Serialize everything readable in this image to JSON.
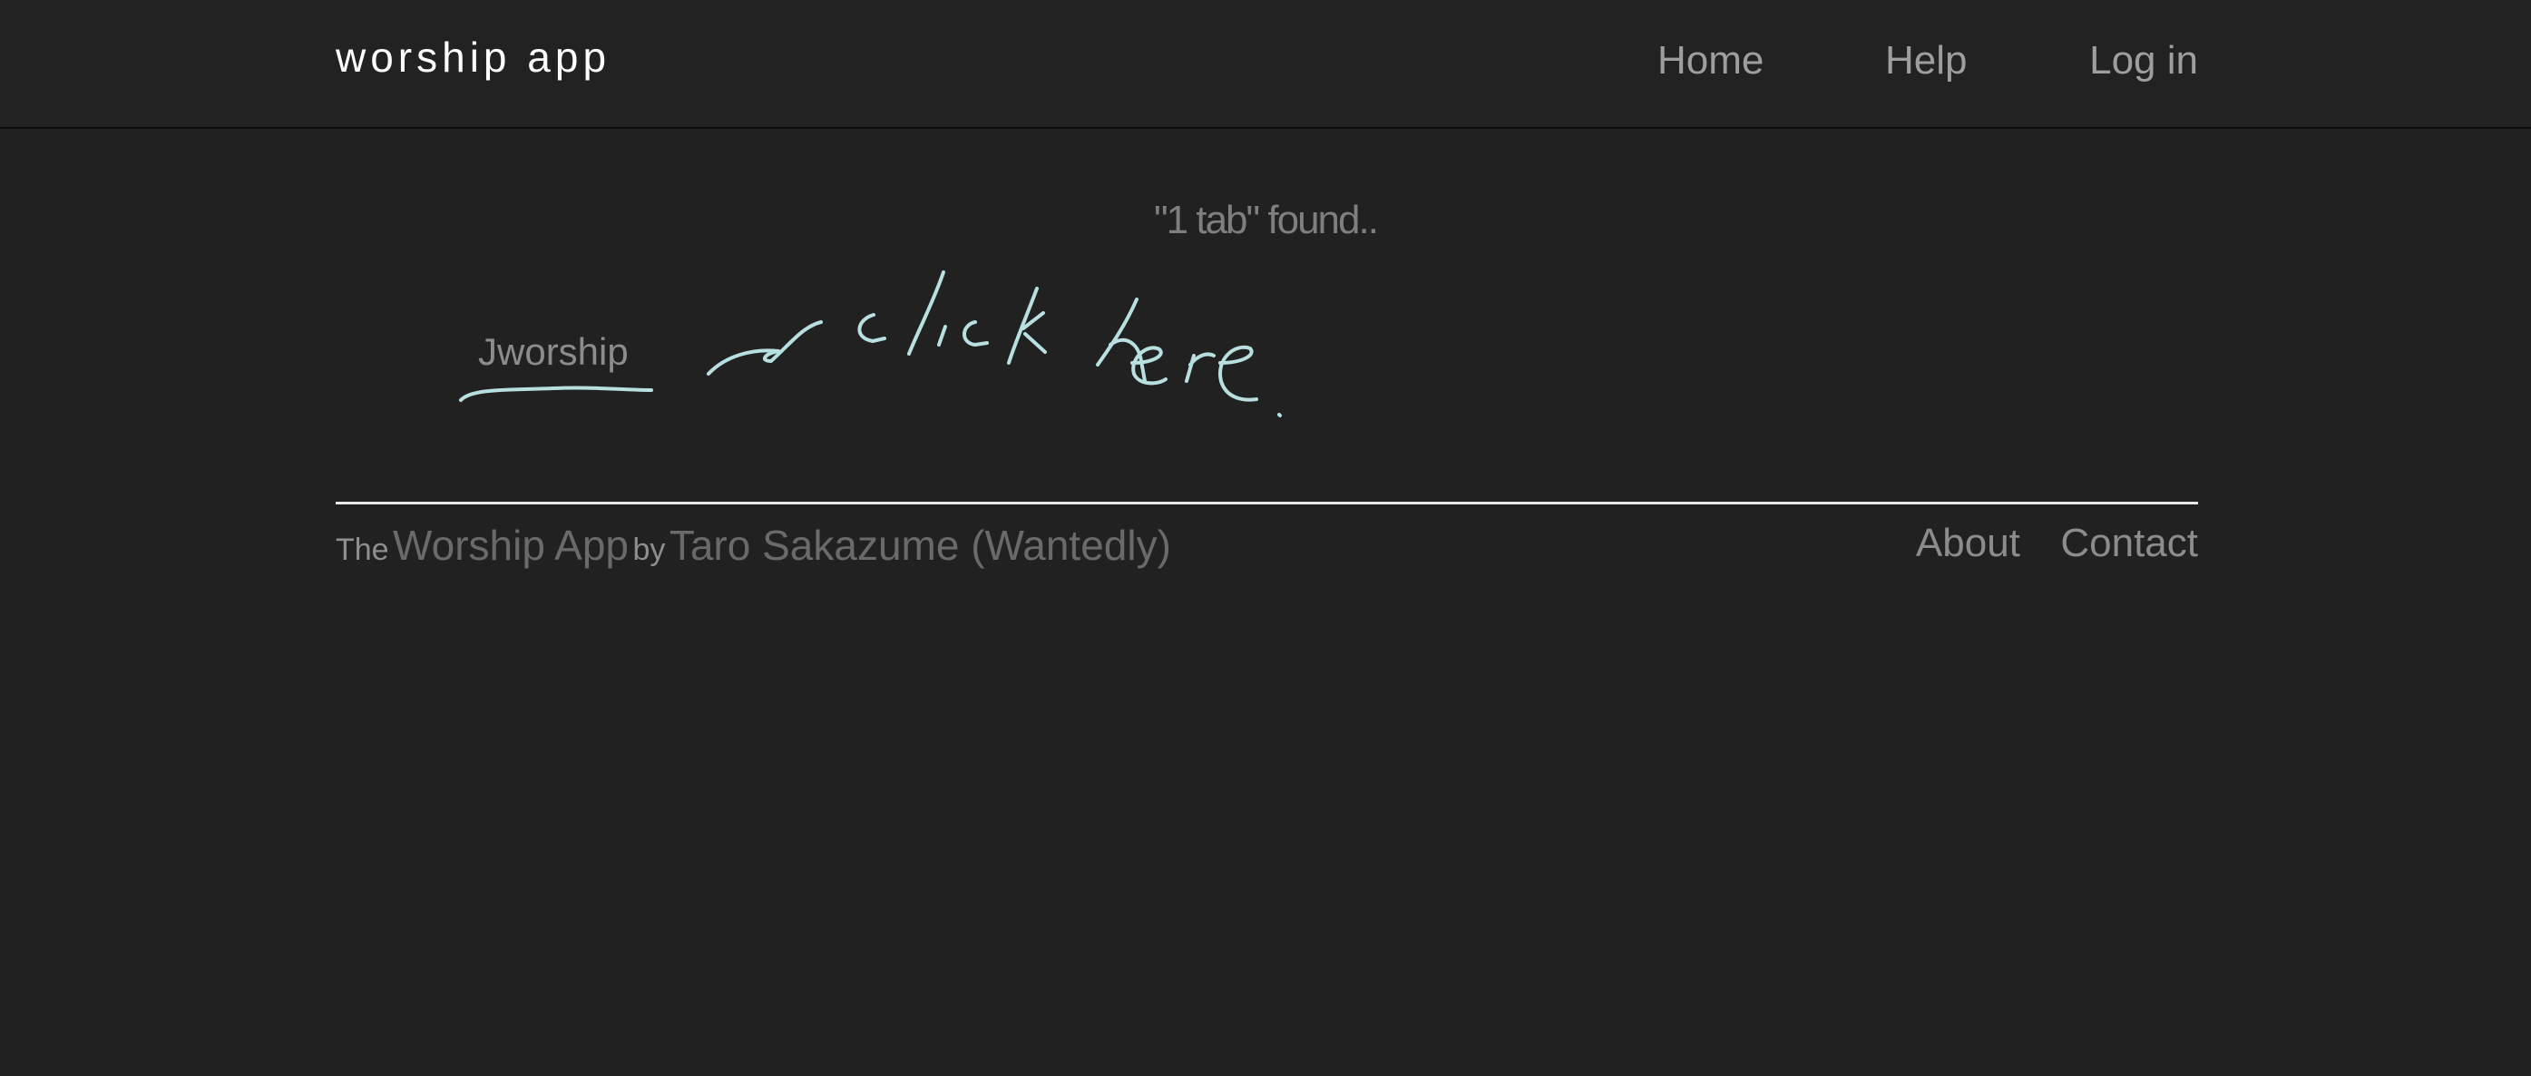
{
  "navbar": {
    "brand": "worship app",
    "links": [
      "Home",
      "Help",
      "Log in"
    ]
  },
  "results": {
    "summary": "\"1 tab\" found..",
    "items": [
      "Jworship"
    ]
  },
  "annotation": {
    "handwritten_text": "click here",
    "ink_color": "#b8e0e0"
  },
  "footer": {
    "prefix": "The",
    "app_name": "Worship App",
    "by": "by",
    "author": "Taro Sakazume (Wantedly)",
    "links": [
      "About",
      "Contact"
    ]
  },
  "colors": {
    "background": "#212121",
    "navbar_border": "#0d0d0d",
    "rule": "#e8e8e8"
  }
}
